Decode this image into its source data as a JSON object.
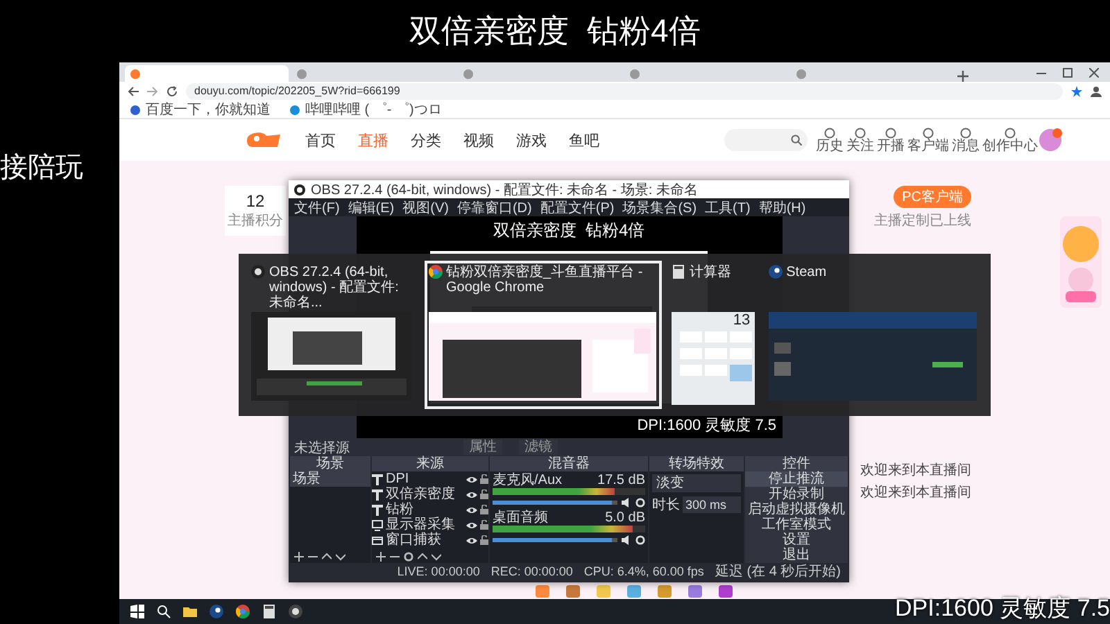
{
  "stream_title": "双倍亲密度  钻粉4倍",
  "side_label": "接陪玩",
  "browser": {
    "tabs": [
      {
        "selected": true
      },
      {
        "selected": false
      },
      {
        "selected": false
      },
      {
        "selected": false
      },
      {
        "selected": false
      }
    ],
    "address": "douyu.com/topic/202205_5W?rid=666199",
    "bookmarks": [
      "百度一下，你就知道",
      "哔哩哔哩 ( ゜- ゜)つロ"
    ]
  },
  "site_nav": {
    "items": [
      {
        "label": "首页",
        "selected": false
      },
      {
        "label": "直播",
        "selected": true
      },
      {
        "label": "分类",
        "selected": false
      },
      {
        "label": "视频",
        "selected": false
      },
      {
        "label": "游戏",
        "selected": false
      },
      {
        "label": "鱼吧",
        "selected": false
      }
    ],
    "shortcuts": [
      "历史",
      "关注",
      "开播",
      "客户端",
      "消息",
      "创作中心"
    ]
  },
  "page": {
    "points_value": "12",
    "points_label": "主播积分",
    "client_button": "PC客户端",
    "client_note": "主播定制已上线",
    "chat": [
      "欢迎来到本直播间",
      "欢迎来到本直播间"
    ]
  },
  "obs": {
    "title": "OBS 27.2.4 (64-bit, windows) - 配置文件: 未命名 - 场景: 未命名",
    "menu": [
      "文件(F)",
      "编辑(E)",
      "视图(V)",
      "停靠窗口(D)",
      "配置文件(P)",
      "场景集合(S)",
      "工具(T)",
      "帮助(H)"
    ],
    "preview_title": "双倍亲密度  钻粉4倍",
    "preview_overlay": "DPI:1600 灵敏度 7.5",
    "toolbar": {
      "label": "未选择源",
      "buttons": [
        "属性",
        "滤镜"
      ]
    },
    "scenes": {
      "header": "场景",
      "items": [
        {
          "label": "场景",
          "selected": true
        }
      ]
    },
    "sources": {
      "header": "来源",
      "items": [
        {
          "label": "DPI",
          "kind": "text"
        },
        {
          "label": "双倍亲密度",
          "kind": "text"
        },
        {
          "label": "钻粉",
          "kind": "text"
        },
        {
          "label": "显示器采集",
          "kind": "display"
        },
        {
          "label": "窗口捕获",
          "kind": "window"
        }
      ]
    },
    "mixer": {
      "header": "混音器",
      "channels": [
        {
          "name": "麦克风/Aux",
          "reading": "17.5 dB",
          "meter": {
            "level": 0.8
          },
          "volume": {
            "level": 0.95
          }
        },
        {
          "name": "桌面音频",
          "reading": "5.0 dB",
          "meter": {
            "level": 0.92
          },
          "volume": {
            "level": 0.95
          }
        }
      ]
    },
    "transitions": {
      "header": "转场特效",
      "type": "淡变",
      "duration_label": "时长",
      "duration": "300 ms"
    },
    "controls": {
      "header": "控件",
      "buttons": [
        "停止推流",
        "开始录制",
        "启动虚拟摄像机",
        "工作室模式",
        "设置",
        "退出"
      ]
    },
    "status": {
      "live": "LIVE: 00:00:00",
      "rec": "REC: 00:00:00",
      "cpu": "CPU: 6.4%, 60.00 fps",
      "delay": "延迟 (在 4 秒后开始)"
    }
  },
  "alt_tab": [
    {
      "title": "OBS 27.2.4 (64-bit, windows) - 配置文件: 未命名...",
      "kind": "obs",
      "selected": false
    },
    {
      "title": "钻粉双倍亲密度_斗鱼直播平台 - Google Chrome",
      "kind": "chrome",
      "selected": true
    },
    {
      "title": "计算器",
      "kind": "calculator",
      "selected": false,
      "display": "13"
    },
    {
      "title": "Steam",
      "kind": "steam",
      "selected": false
    }
  ],
  "taskbar": [
    {
      "kind": "start"
    },
    {
      "kind": "search"
    },
    {
      "kind": "explorer"
    },
    {
      "kind": "steam"
    },
    {
      "kind": "chrome"
    },
    {
      "kind": "calculator"
    },
    {
      "kind": "obs"
    }
  ],
  "overlay": "DPI:1600 灵敏度 7.5"
}
